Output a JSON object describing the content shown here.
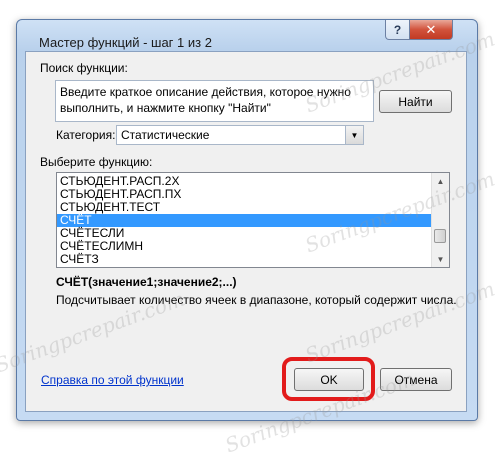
{
  "window": {
    "title": "Мастер функций - шаг 1 из 2",
    "help_glyph": "?",
    "close_glyph": "✕"
  },
  "search": {
    "label": "Поиск функции:",
    "value": "Введите краткое описание действия, которое нужно выполнить, и нажмите кнопку \"Найти\"",
    "find_button": "Найти"
  },
  "category": {
    "label": "Категория:",
    "selected": "Статистические"
  },
  "functions": {
    "label": "Выберите функцию:",
    "items": [
      "СТЬЮДЕНТ.РАСП.2Х",
      "СТЬЮДЕНТ.РАСП.ПХ",
      "СТЬЮДЕНТ.ТЕСТ",
      "СЧЁТ",
      "СЧЁТЕСЛИ",
      "СЧЁТЕСЛИМН",
      "СЧЁТЗ"
    ],
    "selected_index": 3
  },
  "details": {
    "syntax": "СЧЁТ(значение1;значение2;...)",
    "description": "Подсчитывает количество ячеек в диапазоне, который содержит числа."
  },
  "footer": {
    "help_link": "Справка по этой функции",
    "ok_button": "OK",
    "cancel_button": "Отмена"
  },
  "watermark_text": "Soringpcrepair.com",
  "colors": {
    "selection": "#3399ff",
    "highlight": "#e21b1b",
    "link": "#0033cc"
  }
}
